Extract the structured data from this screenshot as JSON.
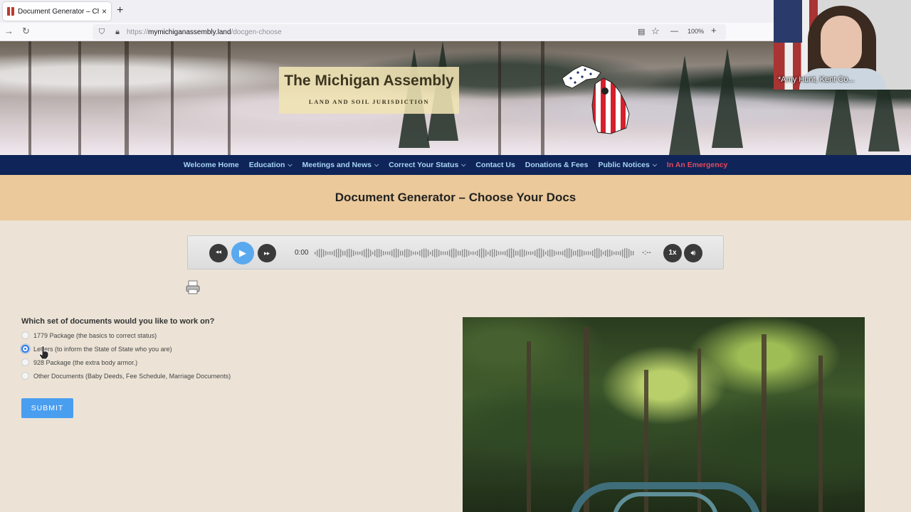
{
  "browser": {
    "tab_title": "Document Generator – Choose",
    "tab_close": "×",
    "new_tab": "+",
    "url_proto": "https://",
    "url_host": "mymichiganassembly.land",
    "url_path": "/docgen-choose",
    "zoom": "100%",
    "zoom_minus": "—",
    "zoom_plus": "+"
  },
  "banner": {
    "title": "The Michigan Assembly",
    "subtitle": "LAND AND SOIL JURISDICTION"
  },
  "webcam": {
    "label": "*Amy Hunt, Kent Co..."
  },
  "menu": [
    {
      "label": "Welcome Home",
      "dropdown": false
    },
    {
      "label": "Education",
      "dropdown": true
    },
    {
      "label": "Meetings and News",
      "dropdown": true
    },
    {
      "label": "Correct Your Status",
      "dropdown": true
    },
    {
      "label": "Contact Us",
      "dropdown": false
    },
    {
      "label": "Donations & Fees",
      "dropdown": false
    },
    {
      "label": "Public Notices",
      "dropdown": true
    },
    {
      "label": "In An Emergency",
      "dropdown": false
    }
  ],
  "page": {
    "title": "Document Generator – Choose Your Docs"
  },
  "player": {
    "current_time": "0:00",
    "duration": "-:--",
    "speed": "1x"
  },
  "form": {
    "question": "Which set of documents would you like to work on?",
    "options": [
      {
        "label": "1779 Package (the basics to correct status)",
        "checked": false
      },
      {
        "label": "Letters (to inform the State of State who you are)",
        "checked": true
      },
      {
        "label": "928 Package (the extra body armor.)",
        "checked": false
      },
      {
        "label": "Other Documents (Baby Deeds, Fee Schedule, Marriage Documents)",
        "checked": false
      }
    ],
    "submit_label": "SUBMIT"
  },
  "colors": {
    "menu_bg": "#0f2458",
    "menu_text": "#a8d4f5",
    "emergency": "#e5495d",
    "title_band": "#ebc99a",
    "page_bg": "#ece3d6",
    "accent": "#4a9ef0"
  }
}
